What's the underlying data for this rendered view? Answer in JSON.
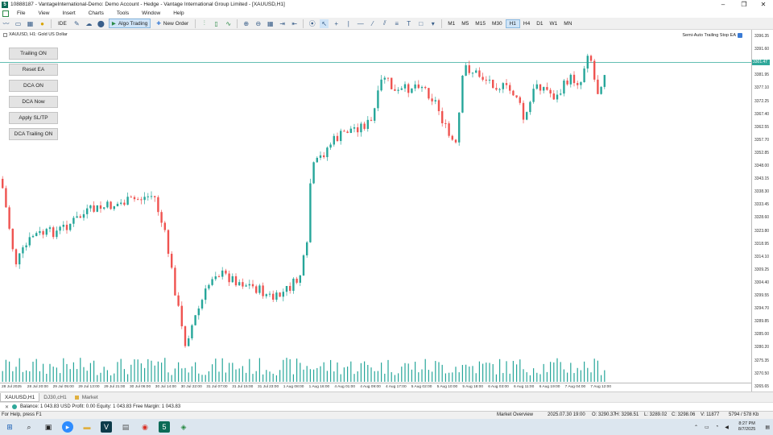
{
  "window": {
    "title": "10888187 - VantageInternational-Demo: Demo Account - Hedge - Vantage International Group Limited - [XAUUSD,H1]"
  },
  "menu": [
    "File",
    "View",
    "Insert",
    "Charts",
    "Tools",
    "Window",
    "Help"
  ],
  "toolbar": {
    "ide": "IDE",
    "algo_trading": "Algo Trading",
    "new_order": "New Order",
    "timeframes": [
      "M1",
      "M5",
      "M15",
      "M30",
      "H1",
      "H4",
      "D1",
      "W1",
      "MN"
    ],
    "active_timeframe": "H1"
  },
  "chart": {
    "symbol_label": "XAUUSD, H1:  Gold US Dollar",
    "ea_label": "Semi-Auto Trailing Stop EA",
    "current_price_tag": "3301.47",
    "buttons": [
      "Trailing ON",
      "Reset EA",
      "DCA ON",
      "DCA Now",
      "Apply SL/TP",
      "DCA Trailing ON"
    ],
    "price_ticks": [
      "3396.35",
      "3391.60",
      "3386.80",
      "3381.95",
      "3377.10",
      "3372.25",
      "3367.40",
      "3362.55",
      "3357.70",
      "3352.85",
      "3348.00",
      "3343.15",
      "3338.30",
      "3333.45",
      "3328.60",
      "3323.80",
      "3318.95",
      "3314.10",
      "3309.25",
      "3304.40",
      "3299.55",
      "3294.70",
      "3289.85",
      "3285.00",
      "3280.20",
      "3275.35",
      "3270.50",
      "3265.65",
      "3260.80",
      "3255.95"
    ],
    "time_ticks": [
      "28 Jul 2025",
      "28 Jul 20:00",
      "29 Jul 05:00",
      "29 Jul 13:00",
      "29 Jul 21:00",
      "30 Jul 06:00",
      "30 Jul 14:00",
      "30 Jul 22:00",
      "31 Jul 07:00",
      "31 Jul 15:00",
      "31 Jul 23:00",
      "1 Aug 08:00",
      "1 Aug 16:00",
      "4 Aug 01:00",
      "4 Aug 09:00",
      "4 Aug 17:00",
      "5 Aug 02:00",
      "5 Aug 10:00",
      "5 Aug 18:00",
      "6 Aug 03:00",
      "6 Aug 11:00",
      "6 Aug 19:00",
      "7 Aug 04:00",
      "7 Aug 12:00"
    ]
  },
  "tabs": [
    "XAUUSD,H1",
    "DJ30,cH1",
    "Market"
  ],
  "balance_line": "Balance: 1 043.83 USD   Profit: 0.00   Equity: 1 043.83   Free Margin: 1 043.83",
  "status": {
    "help": "For Help, press F1",
    "profile": "Market Overview",
    "datetime": "2025.07.30 19:00",
    "open": "O: 3290.37",
    "high": "H: 3298.51",
    "low": "L: 3289.02",
    "close": "C: 3298.06",
    "volume": "V: 11877",
    "traffic": "5794 / 578 Kb"
  },
  "taskbar": {
    "time": "8:27 PM",
    "date": "8/7/2025"
  },
  "colors": {
    "bull": "#26a69a",
    "bear": "#ef5350",
    "price_line": "#2fa89a",
    "volume": "#26a69a"
  }
}
